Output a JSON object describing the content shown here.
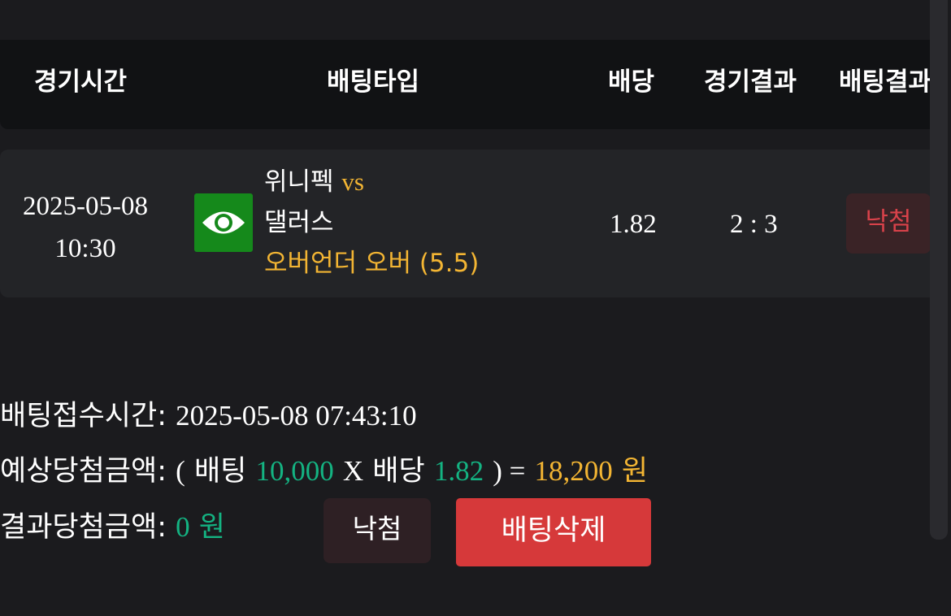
{
  "table": {
    "headers": {
      "time": "경기시간",
      "type": "배팅타입",
      "odds": "배당",
      "result": "경기결과",
      "bet_result": "배팅결과"
    },
    "row": {
      "date": "2025-05-08",
      "time": "10:30",
      "team_icon": "eye-icon",
      "home": "위니펙",
      "vs": "vs",
      "away": "댈러스",
      "bet_type": "오버언더 오버 (5.5)",
      "odds": "1.82",
      "score": "2 : 3",
      "bet_result": "낙첨"
    }
  },
  "summary": {
    "received_label": "배팅접수시간:",
    "received_value": "2025-05-08 07:43:10",
    "expected_label": "예상당첨금액:",
    "open_paren": "(",
    "bet_word": "배팅",
    "bet_amount": "10,000",
    "times": "X",
    "odds_word": "배당",
    "odds_value": "1.82",
    "close_eq": ") =",
    "expected_amount": "18,200",
    "won": "원",
    "result_label": "결과당첨금액:",
    "result_amount": "0",
    "result_won": "원"
  },
  "buttons": {
    "status": "낙첨",
    "delete": "배팅삭제"
  },
  "colors": {
    "accent_gold": "#f3b533",
    "accent_green": "#14b382",
    "lose_red": "#d8424a",
    "delete_red": "#d6393a"
  }
}
